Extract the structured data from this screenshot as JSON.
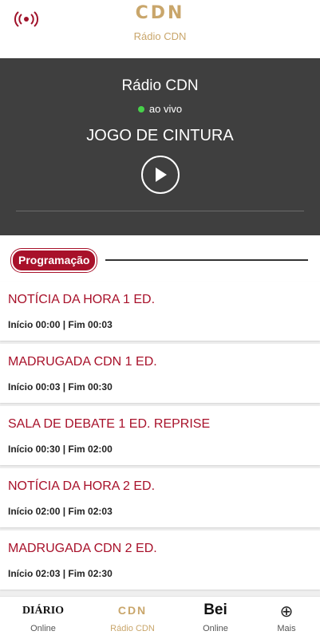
{
  "header": {
    "logo": "CDN",
    "subtitle": "Rádio CDN",
    "radio_icon": "broadcast-icon",
    "accent_color": "#a8112a",
    "gold_color": "#c9a66b"
  },
  "player": {
    "station": "Rádio CDN",
    "live_label": "ao vivo",
    "program": "JOGO DE CINTURA",
    "play_icon": "play-icon",
    "live_dot_color": "#47d14a"
  },
  "schedule": {
    "label": "Programação",
    "items": [
      {
        "title": "NOTÍCIA DA HORA 1 ED.",
        "time": "Início 00:00 | Fim 00:03"
      },
      {
        "title": "MADRUGADA CDN 1 ED.",
        "time": "Início 00:03 | Fim 00:30"
      },
      {
        "title": "SALA DE DEBATE 1 ED. REPRISE",
        "time": "Início 00:30 | Fim 02:00"
      },
      {
        "title": "NOTÍCIA DA HORA 2 ED.",
        "time": "Início 02:00 | Fim 02:03"
      },
      {
        "title": "MADRUGADA CDN 2 ED.",
        "time": "Início 02:03 | Fim 02:30"
      }
    ]
  },
  "tabs": [
    {
      "title": "DIÁRIO",
      "sub": "Online"
    },
    {
      "title": "CDN",
      "sub": "Rádio CDN"
    },
    {
      "title": "Bei",
      "sub": "Online"
    },
    {
      "title": "⊕",
      "sub": "Mais"
    }
  ]
}
